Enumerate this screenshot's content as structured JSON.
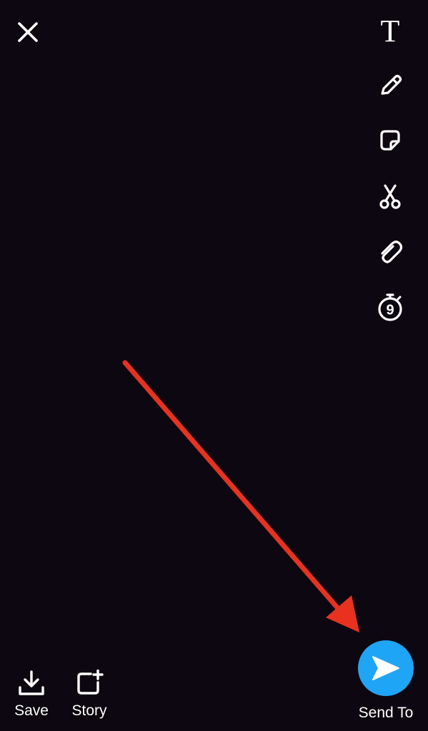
{
  "toolbar": {
    "close_icon": "close-icon",
    "tools": [
      {
        "name": "text-tool",
        "icon": "text-t-icon",
        "glyph": "T"
      },
      {
        "name": "pencil-tool",
        "icon": "pencil-icon"
      },
      {
        "name": "sticker-tool",
        "icon": "sticker-icon"
      },
      {
        "name": "scissors-tool",
        "icon": "scissors-icon"
      },
      {
        "name": "paperclip-tool",
        "icon": "paperclip-icon"
      },
      {
        "name": "timer-tool",
        "icon": "timer-icon",
        "timer_value": "9"
      }
    ]
  },
  "bottom": {
    "save_label": "Save",
    "story_label": "Story",
    "send_label": "Send To"
  },
  "colors": {
    "background": "#0c0710",
    "send_button": "#1ea5f5",
    "annotation_arrow": "#e8321f",
    "icon": "#ffffff"
  }
}
